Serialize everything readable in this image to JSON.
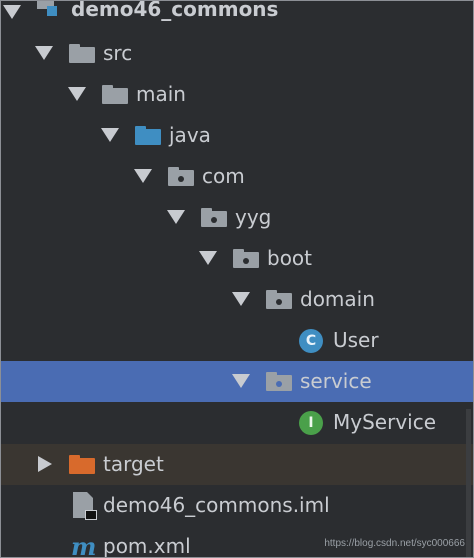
{
  "tree": {
    "root": {
      "label": "demo46_commons",
      "icon": "module-icon"
    },
    "src": {
      "label": "src",
      "icon": "folder-icon"
    },
    "main": {
      "label": "main",
      "icon": "folder-icon"
    },
    "java": {
      "label": "java",
      "icon": "source-folder-icon"
    },
    "com": {
      "label": "com",
      "icon": "package-icon"
    },
    "yyg": {
      "label": "yyg",
      "icon": "package-icon"
    },
    "boot": {
      "label": "boot",
      "icon": "package-icon"
    },
    "domain": {
      "label": "domain",
      "icon": "package-icon"
    },
    "user": {
      "label": "User",
      "badge": "C",
      "icon": "class-icon"
    },
    "service": {
      "label": "service",
      "icon": "package-icon",
      "selected": true
    },
    "myservice": {
      "label": "MyService",
      "badge": "I",
      "icon": "interface-icon"
    },
    "target": {
      "label": "target",
      "icon": "excluded-folder-icon"
    },
    "iml": {
      "label": "demo46_commons.iml",
      "icon": "iml-file-icon"
    },
    "pom": {
      "label": "pom.xml",
      "icon": "maven-icon",
      "glyph": "m"
    }
  },
  "watermark": "https://blog.csdn.net/syc000666",
  "colors": {
    "background": "#2b2d30",
    "selection": "#4a6cb3",
    "excluded_row": "#3a3631",
    "text": "#c9ccd1",
    "folder_gray": "#9aa0a6",
    "source_blue": "#3f8ec2",
    "excluded_orange": "#d86a2c",
    "interface_green": "#4aa04a"
  }
}
